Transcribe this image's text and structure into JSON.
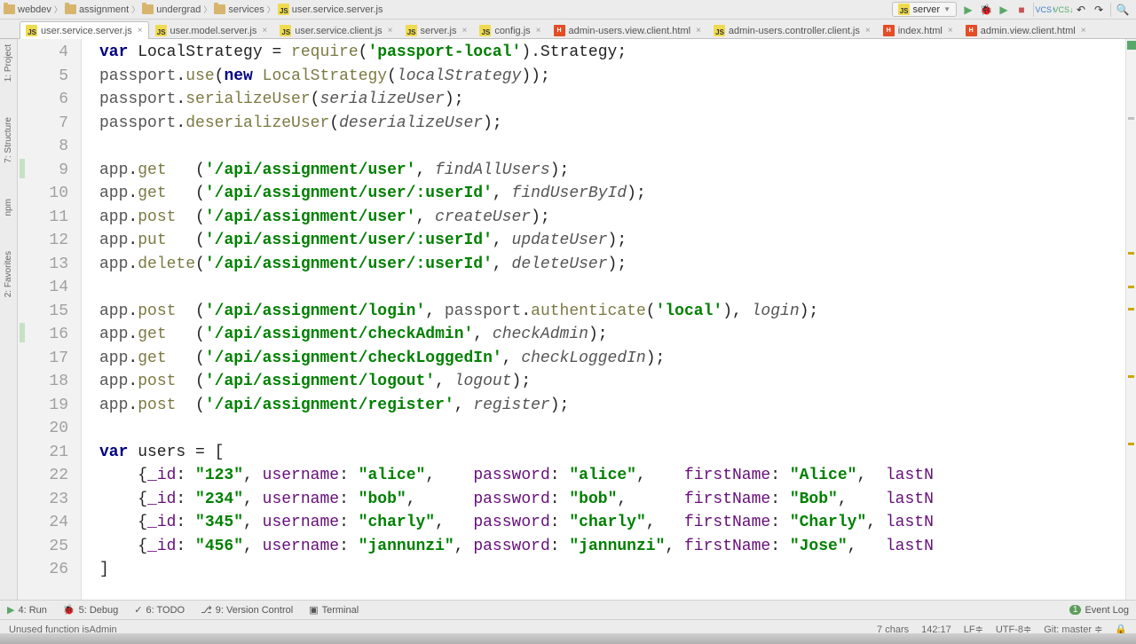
{
  "breadcrumb": [
    "webdev",
    "assignment",
    "undergrad",
    "services",
    "user.service.server.js"
  ],
  "breadcrumbTypes": [
    "folder",
    "folder",
    "folder",
    "folder",
    "js"
  ],
  "runConfig": {
    "label": "server"
  },
  "toolbar": {
    "run": "▶",
    "debug": "🐞",
    "stop": "■",
    "vcsUp": "VCS↑",
    "vcsDown": "VCS↓",
    "undo": "↶",
    "redo": "↷",
    "search": "🔍"
  },
  "tabs": [
    {
      "label": "user.service.server.js",
      "icon": "js",
      "active": true
    },
    {
      "label": "user.model.server.js",
      "icon": "js"
    },
    {
      "label": "user.service.client.js",
      "icon": "js"
    },
    {
      "label": "server.js",
      "icon": "js"
    },
    {
      "label": "config.js",
      "icon": "js"
    },
    {
      "label": "admin-users.view.client.html",
      "icon": "html"
    },
    {
      "label": "admin-users.controller.client.js",
      "icon": "js"
    },
    {
      "label": "index.html",
      "icon": "html"
    },
    {
      "label": "admin.view.client.html",
      "icon": "html"
    }
  ],
  "leftTools": [
    {
      "label": "1: Project"
    },
    {
      "label": "7: Structure"
    },
    {
      "label": "npm"
    },
    {
      "label": "2: Favorites"
    }
  ],
  "code": {
    "firstLine": 4,
    "lines": [
      {
        "tokens": [
          [
            "kw2",
            "var"
          ],
          [
            "def",
            " LocalStrategy "
          ],
          [
            "def",
            "= "
          ],
          [
            "fn",
            "require"
          ],
          [
            "def",
            "("
          ],
          [
            "str",
            "'passport-local'"
          ],
          [
            "def",
            ").Strategy;"
          ]
        ]
      },
      {
        "tokens": [
          [
            "id",
            "passport"
          ],
          [
            "def",
            "."
          ],
          [
            "fn",
            "use"
          ],
          [
            "def",
            "("
          ],
          [
            "kw2",
            "new"
          ],
          [
            "def",
            " "
          ],
          [
            "fn",
            "LocalStrategy"
          ],
          [
            "def",
            "("
          ],
          [
            "param",
            "localStrategy"
          ],
          [
            "def",
            "));"
          ]
        ]
      },
      {
        "tokens": [
          [
            "id",
            "passport"
          ],
          [
            "def",
            "."
          ],
          [
            "fn",
            "serializeUser"
          ],
          [
            "def",
            "("
          ],
          [
            "param",
            "serializeUser"
          ],
          [
            "def",
            ");"
          ]
        ]
      },
      {
        "tokens": [
          [
            "id",
            "passport"
          ],
          [
            "def",
            "."
          ],
          [
            "fn",
            "deserializeUser"
          ],
          [
            "def",
            "("
          ],
          [
            "param",
            "deserializeUser"
          ],
          [
            "def",
            ");"
          ]
        ]
      },
      {
        "tokens": []
      },
      {
        "mark": true,
        "tokens": [
          [
            "id",
            "app"
          ],
          [
            "def",
            "."
          ],
          [
            "fn",
            "get"
          ],
          [
            "def",
            "   ("
          ],
          [
            "str",
            "'/api/assignment/user'"
          ],
          [
            "def",
            ", "
          ],
          [
            "param",
            "findAllUsers"
          ],
          [
            "def",
            ");"
          ]
        ]
      },
      {
        "tokens": [
          [
            "id",
            "app"
          ],
          [
            "def",
            "."
          ],
          [
            "fn",
            "get"
          ],
          [
            "def",
            "   ("
          ],
          [
            "str",
            "'/api/assignment/user/:userId'"
          ],
          [
            "def",
            ", "
          ],
          [
            "param",
            "findUserById"
          ],
          [
            "def",
            ");"
          ]
        ]
      },
      {
        "tokens": [
          [
            "id",
            "app"
          ],
          [
            "def",
            "."
          ],
          [
            "fn",
            "post"
          ],
          [
            "def",
            "  ("
          ],
          [
            "str",
            "'/api/assignment/user'"
          ],
          [
            "def",
            ", "
          ],
          [
            "param",
            "createUser"
          ],
          [
            "def",
            ");"
          ]
        ]
      },
      {
        "tokens": [
          [
            "id",
            "app"
          ],
          [
            "def",
            "."
          ],
          [
            "fn",
            "put"
          ],
          [
            "def",
            "   ("
          ],
          [
            "str",
            "'/api/assignment/user/:userId'"
          ],
          [
            "def",
            ", "
          ],
          [
            "param",
            "updateUser"
          ],
          [
            "def",
            ");"
          ]
        ]
      },
      {
        "tokens": [
          [
            "id",
            "app"
          ],
          [
            "def",
            "."
          ],
          [
            "fn",
            "delete"
          ],
          [
            "def",
            "("
          ],
          [
            "str",
            "'/api/assignment/user/:userId'"
          ],
          [
            "def",
            ", "
          ],
          [
            "param",
            "deleteUser"
          ],
          [
            "def",
            ");"
          ]
        ]
      },
      {
        "tokens": []
      },
      {
        "tokens": [
          [
            "id",
            "app"
          ],
          [
            "def",
            "."
          ],
          [
            "fn",
            "post"
          ],
          [
            "def",
            "  ("
          ],
          [
            "str",
            "'/api/assignment/login'"
          ],
          [
            "def",
            ", "
          ],
          [
            "id",
            "passport"
          ],
          [
            "def",
            "."
          ],
          [
            "fn",
            "authenticate"
          ],
          [
            "def",
            "("
          ],
          [
            "str",
            "'local'"
          ],
          [
            "def",
            "), "
          ],
          [
            "param",
            "login"
          ],
          [
            "def",
            ");"
          ]
        ]
      },
      {
        "mark": true,
        "tokens": [
          [
            "id",
            "app"
          ],
          [
            "def",
            "."
          ],
          [
            "fn",
            "get"
          ],
          [
            "def",
            "   ("
          ],
          [
            "str",
            "'/api/assignment/checkAdmin'"
          ],
          [
            "def",
            ", "
          ],
          [
            "param",
            "checkAdmin"
          ],
          [
            "def",
            ");"
          ]
        ]
      },
      {
        "tokens": [
          [
            "id",
            "app"
          ],
          [
            "def",
            "."
          ],
          [
            "fn",
            "get"
          ],
          [
            "def",
            "   ("
          ],
          [
            "str",
            "'/api/assignment/checkLoggedIn'"
          ],
          [
            "def",
            ", "
          ],
          [
            "param",
            "checkLoggedIn"
          ],
          [
            "def",
            ");"
          ]
        ]
      },
      {
        "tokens": [
          [
            "id",
            "app"
          ],
          [
            "def",
            "."
          ],
          [
            "fn",
            "post"
          ],
          [
            "def",
            "  ("
          ],
          [
            "str",
            "'/api/assignment/logout'"
          ],
          [
            "def",
            ", "
          ],
          [
            "param",
            "logout"
          ],
          [
            "def",
            ");"
          ]
        ]
      },
      {
        "tokens": [
          [
            "id",
            "app"
          ],
          [
            "def",
            "."
          ],
          [
            "fn",
            "post"
          ],
          [
            "def",
            "  ("
          ],
          [
            "str",
            "'/api/assignment/register'"
          ],
          [
            "def",
            ", "
          ],
          [
            "param",
            "register"
          ],
          [
            "def",
            ");"
          ]
        ]
      },
      {
        "tokens": []
      },
      {
        "tokens": [
          [
            "kw2",
            "var"
          ],
          [
            "def",
            " users = ["
          ]
        ]
      },
      {
        "tokens": [
          [
            "def",
            "    {"
          ],
          [
            "prop",
            "_id"
          ],
          [
            "def",
            ": "
          ],
          [
            "str",
            "\"123\""
          ],
          [
            "def",
            ", "
          ],
          [
            "prop",
            "username"
          ],
          [
            "def",
            ": "
          ],
          [
            "str",
            "\"alice\""
          ],
          [
            "def",
            ",    "
          ],
          [
            "prop",
            "password"
          ],
          [
            "def",
            ": "
          ],
          [
            "str",
            "\"alice\""
          ],
          [
            "def",
            ",    "
          ],
          [
            "prop",
            "firstName"
          ],
          [
            "def",
            ": "
          ],
          [
            "str",
            "\"Alice\""
          ],
          [
            "def",
            ",  "
          ],
          [
            "prop",
            "lastN"
          ]
        ]
      },
      {
        "tokens": [
          [
            "def",
            "    {"
          ],
          [
            "prop",
            "_id"
          ],
          [
            "def",
            ": "
          ],
          [
            "str",
            "\"234\""
          ],
          [
            "def",
            ", "
          ],
          [
            "prop",
            "username"
          ],
          [
            "def",
            ": "
          ],
          [
            "str",
            "\"bob\""
          ],
          [
            "def",
            ",      "
          ],
          [
            "prop",
            "password"
          ],
          [
            "def",
            ": "
          ],
          [
            "str",
            "\"bob\""
          ],
          [
            "def",
            ",      "
          ],
          [
            "prop",
            "firstName"
          ],
          [
            "def",
            ": "
          ],
          [
            "str",
            "\"Bob\""
          ],
          [
            "def",
            ",    "
          ],
          [
            "prop",
            "lastN"
          ]
        ]
      },
      {
        "tokens": [
          [
            "def",
            "    {"
          ],
          [
            "prop",
            "_id"
          ],
          [
            "def",
            ": "
          ],
          [
            "str",
            "\"345\""
          ],
          [
            "def",
            ", "
          ],
          [
            "prop",
            "username"
          ],
          [
            "def",
            ": "
          ],
          [
            "str",
            "\"charly\""
          ],
          [
            "def",
            ",   "
          ],
          [
            "prop",
            "password"
          ],
          [
            "def",
            ": "
          ],
          [
            "str",
            "\"charly\""
          ],
          [
            "def",
            ",   "
          ],
          [
            "prop",
            "firstName"
          ],
          [
            "def",
            ": "
          ],
          [
            "str",
            "\"Charly\""
          ],
          [
            "def",
            ", "
          ],
          [
            "prop",
            "lastN"
          ]
        ]
      },
      {
        "tokens": [
          [
            "def",
            "    {"
          ],
          [
            "prop",
            "_id"
          ],
          [
            "def",
            ": "
          ],
          [
            "str",
            "\"456\""
          ],
          [
            "def",
            ", "
          ],
          [
            "prop",
            "username"
          ],
          [
            "def",
            ": "
          ],
          [
            "str",
            "\"jannunzi\""
          ],
          [
            "def",
            ", "
          ],
          [
            "prop",
            "password"
          ],
          [
            "def",
            ": "
          ],
          [
            "str",
            "\"jannunzi\""
          ],
          [
            "def",
            ", "
          ],
          [
            "prop",
            "firstName"
          ],
          [
            "def",
            ": "
          ],
          [
            "str",
            "\"Jose\""
          ],
          [
            "def",
            ",   "
          ],
          [
            "prop",
            "lastN"
          ]
        ]
      },
      {
        "tokens": [
          [
            "def",
            "]"
          ]
        ]
      }
    ]
  },
  "bottomTools": [
    {
      "icon": "▶",
      "label": "4: Run",
      "color": "#59a869"
    },
    {
      "icon": "🐞",
      "label": "5: Debug",
      "color": "#59a869"
    },
    {
      "icon": "✓",
      "label": "6: TODO"
    },
    {
      "icon": "⎇",
      "label": "9: Version Control"
    },
    {
      "icon": "▣",
      "label": "Terminal"
    }
  ],
  "eventLog": {
    "badge": "1",
    "label": "Event Log"
  },
  "status": {
    "message": "Unused function isAdmin",
    "chars": "7 chars",
    "pos": "142:17",
    "le": "LF≑",
    "enc": "UTF-8≑",
    "git": "Git: master ≑",
    "lock": "🔒"
  }
}
